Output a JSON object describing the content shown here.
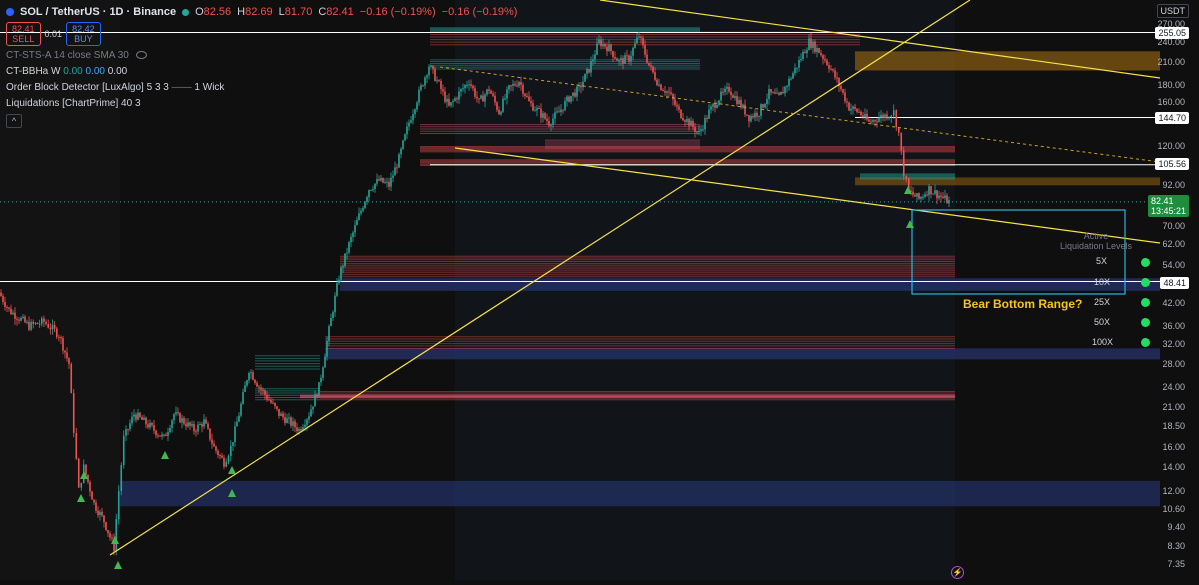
{
  "header": {
    "symbol": "SOL / TetherUS · 1D · Binance",
    "open_key": "O",
    "open": "82.56",
    "high_key": "H",
    "high": "82.69",
    "low_key": "L",
    "low": "81.70",
    "close_key": "C",
    "close": "82.41",
    "change": "−0.16 (−0.19%)",
    "change2": "−0.16 (−0.19%)"
  },
  "trade": {
    "sell_price": "82.41",
    "sell_label": "SELL",
    "spread": "0.01",
    "buy_price": "82.42",
    "buy_label": "BUY"
  },
  "indicators": [
    {
      "name": "CT-STS-A 14 close SMA 30"
    },
    {
      "name": "CT-BBHa W",
      "v1": "0.00",
      "v2": "0.00",
      "v3": "0.00"
    },
    {
      "name": "Order Block Detector [LuxAlgo] 5 3 3",
      "extra": "1 Wick"
    },
    {
      "name": "Liquidations [ChartPrime] 40 3"
    }
  ],
  "collapse_label": "^",
  "currency": "USDT",
  "axis_ticks": [
    "270.00",
    "240.00",
    "210.00",
    "180.00",
    "160.00",
    "120.00",
    "92.00",
    "70.00",
    "62.00",
    "54.00",
    "42.00",
    "36.00",
    "32.00",
    "28.00",
    "24.00",
    "21.00",
    "18.50",
    "16.00",
    "14.00",
    "12.00",
    "10.60",
    "9.40",
    "8.30",
    "7.35"
  ],
  "price_tags": {
    "p255": "255.05",
    "p144": "144.70",
    "p105": "105.56",
    "p48": "48.41",
    "last": "82.41",
    "countdown": "13:45:21"
  },
  "liquidation_panel": {
    "title_line1": "Active",
    "title_line2": "Liquidation Levels",
    "rows": [
      "5X",
      "10X",
      "25X",
      "50X",
      "100X"
    ],
    "dot_color": "#22dd66"
  },
  "annotation": "Bear Bottom Range?",
  "colors": {
    "up": "#26a69a",
    "down": "#ef5350",
    "trendline": "#f5e14a",
    "white_level": "#ffffff",
    "blue_zone": "#2a3a80",
    "orange_zone": "#a06a10",
    "teal_box": "#28b8d8"
  },
  "chart_data": {
    "type": "candlestick",
    "title": "SOL / TetherUS · 1D · Binance",
    "y_scale": "log",
    "ylim": [
      7.0,
      290
    ],
    "price_path": [
      [
        0,
        45
      ],
      [
        10,
        40
      ],
      [
        20,
        38
      ],
      [
        30,
        36
      ],
      [
        45,
        37
      ],
      [
        60,
        34
      ],
      [
        70,
        28
      ],
      [
        75,
        18
      ],
      [
        80,
        12
      ],
      [
        85,
        14
      ],
      [
        95,
        11
      ],
      [
        105,
        9.8
      ],
      [
        115,
        8.2
      ],
      [
        120,
        12
      ],
      [
        125,
        17
      ],
      [
        135,
        20
      ],
      [
        145,
        19
      ],
      [
        155,
        18
      ],
      [
        165,
        17
      ],
      [
        175,
        20
      ],
      [
        185,
        19
      ],
      [
        195,
        18
      ],
      [
        205,
        19
      ],
      [
        215,
        16
      ],
      [
        225,
        14.5
      ],
      [
        232,
        16
      ],
      [
        240,
        20
      ],
      [
        250,
        27
      ],
      [
        260,
        24
      ],
      [
        270,
        22
      ],
      [
        280,
        20
      ],
      [
        290,
        19
      ],
      [
        300,
        18
      ],
      [
        310,
        20
      ],
      [
        320,
        24
      ],
      [
        330,
        35
      ],
      [
        340,
        50
      ],
      [
        350,
        62
      ],
      [
        360,
        75
      ],
      [
        370,
        90
      ],
      [
        380,
        95
      ],
      [
        390,
        92
      ],
      [
        400,
        110
      ],
      [
        410,
        140
      ],
      [
        420,
        170
      ],
      [
        430,
        205
      ],
      [
        440,
        180
      ],
      [
        450,
        155
      ],
      [
        460,
        170
      ],
      [
        470,
        185
      ],
      [
        480,
        160
      ],
      [
        490,
        175
      ],
      [
        500,
        150
      ],
      [
        510,
        175
      ],
      [
        520,
        185
      ],
      [
        530,
        160
      ],
      [
        540,
        150
      ],
      [
        550,
        140
      ],
      [
        560,
        150
      ],
      [
        570,
        165
      ],
      [
        580,
        175
      ],
      [
        590,
        200
      ],
      [
        600,
        240
      ],
      [
        610,
        230
      ],
      [
        620,
        210
      ],
      [
        630,
        215
      ],
      [
        640,
        250
      ],
      [
        650,
        205
      ],
      [
        660,
        180
      ],
      [
        670,
        170
      ],
      [
        680,
        150
      ],
      [
        690,
        140
      ],
      [
        700,
        130
      ],
      [
        710,
        150
      ],
      [
        720,
        165
      ],
      [
        730,
        175
      ],
      [
        740,
        160
      ],
      [
        750,
        145
      ],
      [
        760,
        150
      ],
      [
        770,
        170
      ],
      [
        780,
        165
      ],
      [
        790,
        185
      ],
      [
        800,
        210
      ],
      [
        810,
        240
      ],
      [
        820,
        225
      ],
      [
        830,
        205
      ],
      [
        840,
        180
      ],
      [
        850,
        155
      ],
      [
        860,
        150
      ],
      [
        870,
        140
      ],
      [
        880,
        145
      ],
      [
        890,
        148
      ],
      [
        895,
        150
      ],
      [
        900,
        130
      ],
      [
        905,
        100
      ],
      [
        910,
        88
      ],
      [
        920,
        84
      ],
      [
        930,
        90
      ],
      [
        940,
        86
      ],
      [
        950,
        82.4
      ]
    ],
    "horizontal_levels": [
      255.05,
      144.7,
      105.56,
      48.41
    ],
    "liquidation_levels": [
      "5X",
      "10X",
      "25X",
      "50X",
      "100X"
    ],
    "annotations": [
      "Bear Bottom Range?"
    ]
  }
}
